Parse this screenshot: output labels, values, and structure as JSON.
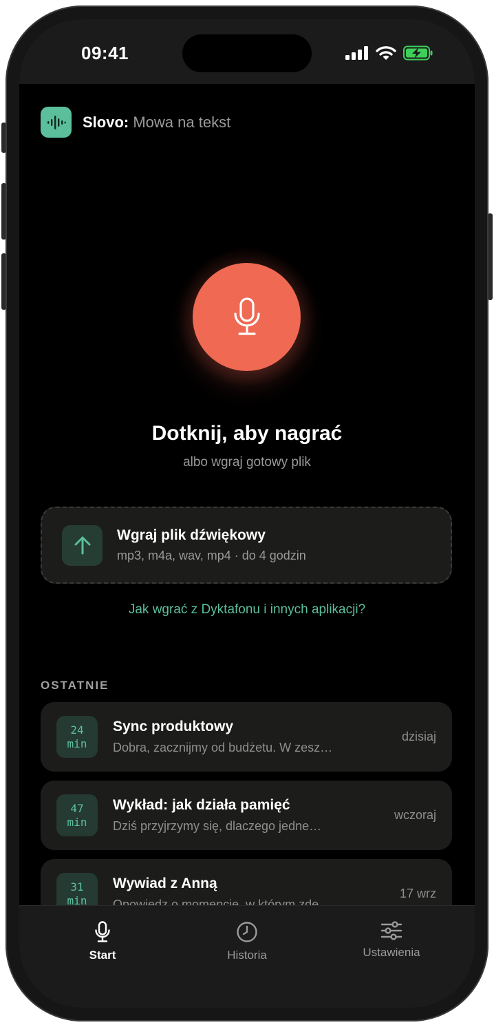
{
  "status_bar": {
    "time": "09:41"
  },
  "header": {
    "brand": "Slovo",
    "separator": ":",
    "subtitle": " Mowa na tekst"
  },
  "record": {
    "title": "Dotknij, aby nagrać",
    "subtitle": "albo wgraj gotowy plik"
  },
  "upload": {
    "title": "Wgraj plik dźwiękowy",
    "formats": "mp3, m4a, wav, mp4 · do 4 godzin"
  },
  "help_link": "Jak wgrać z Dyktafonu i innych aplikacji?",
  "recent": {
    "section_title": "OSTATNIE",
    "items": [
      {
        "minutes": "24",
        "unit": "min",
        "title": "Sync produktowy",
        "preview": "Dobra, zacznijmy od budżetu. W zesz…",
        "date": "dzisiaj"
      },
      {
        "minutes": "47",
        "unit": "min",
        "title": "Wykład: jak działa pamięć",
        "preview": "Dziś przyjrzymy się, dlaczego jedne…",
        "date": "wczoraj"
      },
      {
        "minutes": "31",
        "unit": "min",
        "title": "Wywiad z Anną",
        "preview": "Opowiedz o momencie, w którym zde…",
        "date": "17 wrz"
      }
    ]
  },
  "tabs": [
    {
      "label": "Start",
      "icon": "mic-icon",
      "active": true
    },
    {
      "label": "Historia",
      "icon": "clock-icon",
      "active": false
    },
    {
      "label": "Ustawienia",
      "icon": "sliders-icon",
      "active": false
    }
  ],
  "colors": {
    "accent": "#5bbf9c",
    "record": "#ef6953",
    "card": "#1c1c1a",
    "background": "#000000"
  }
}
